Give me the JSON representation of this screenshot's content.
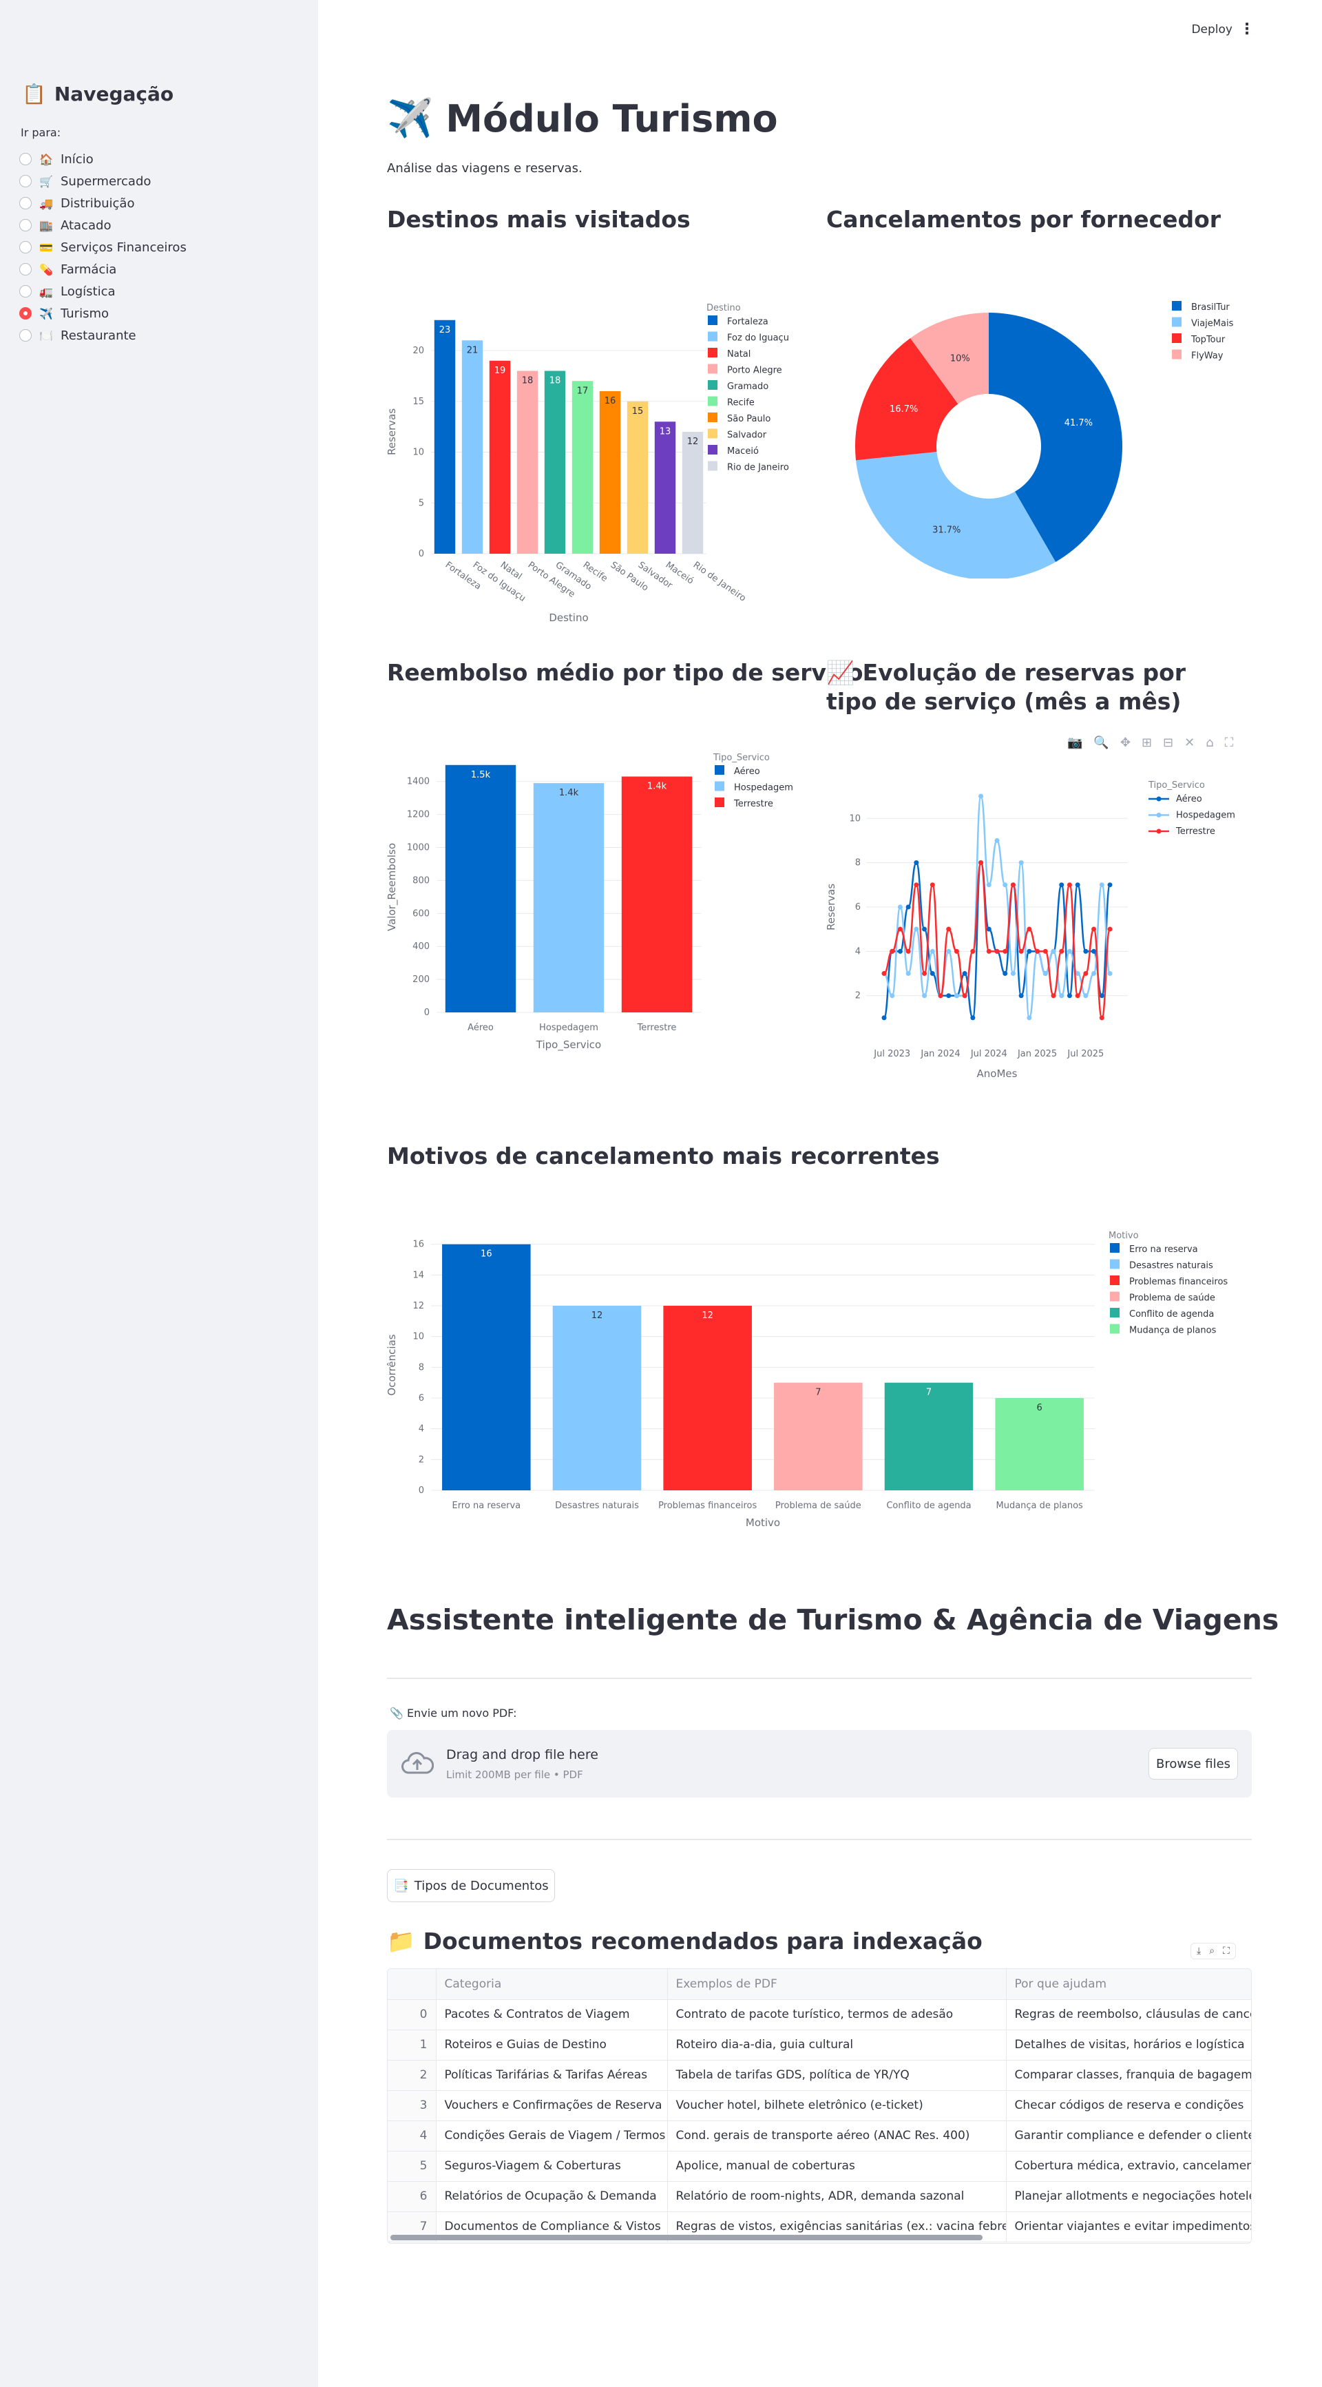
{
  "sidebar": {
    "title": "Navegação",
    "title_icon": "📋",
    "label": "Ir para:",
    "items": [
      {
        "icon": "🏠",
        "label": "Início",
        "selected": false
      },
      {
        "icon": "🛒",
        "label": "Supermercado",
        "selected": false
      },
      {
        "icon": "🚚",
        "label": "Distribuição",
        "selected": false
      },
      {
        "icon": "🏬",
        "label": "Atacado",
        "selected": false
      },
      {
        "icon": "💳",
        "label": "Serviços Financeiros",
        "selected": false
      },
      {
        "icon": "💊",
        "label": "Farmácia",
        "selected": false
      },
      {
        "icon": "🚛",
        "label": "Logística",
        "selected": false
      },
      {
        "icon": "✈️",
        "label": "Turismo",
        "selected": true
      },
      {
        "icon": "🍽️",
        "label": "Restaurante",
        "selected": false
      }
    ]
  },
  "header": {
    "deploy": "Deploy",
    "menu": "⋮"
  },
  "page": {
    "title": "Módulo Turismo",
    "title_icon": "✈️",
    "subtitle": "Análise das viagens e reservas."
  },
  "sections": {
    "destinos": "Destinos mais visitados",
    "cancelamentos": "Cancelamentos por fornecedor",
    "reembolso": "Reembolso médio por tipo de serviço",
    "evolucao_icon": "📈",
    "evolucao": "Evolução de reservas por tipo de serviço (mês a mês)",
    "motivos": "Motivos de cancelamento mais recorrentes",
    "assistente": "Assistente inteligente de Turismo & Agência de Viagens",
    "docs_icon": "📁",
    "docs": "Documentos recomendados para indexação"
  },
  "colors": {
    "palette": [
      "#0068c9",
      "#83c9ff",
      "#ff2b2b",
      "#ffabab",
      "#29b09d",
      "#7defa1",
      "#ff8700",
      "#ffd16a",
      "#6d3fc0",
      "#d5dae5"
    ],
    "accent": "#ff4b4b"
  },
  "chart_data": [
    {
      "type": "bar",
      "title": "",
      "xlabel": "Destino",
      "ylabel": "Reservas",
      "legend_title": "Destino",
      "categories": [
        "Fortaleza",
        "Foz do Iguaçu",
        "Natal",
        "Porto Alegre",
        "Gramado",
        "Recife",
        "São Paulo",
        "Salvador",
        "Maceió",
        "Rio de Janeiro"
      ],
      "values": [
        23,
        21,
        19,
        18,
        18,
        17,
        16,
        15,
        13,
        12
      ],
      "labels": [
        "23",
        "21",
        "19",
        "18",
        "18",
        "17",
        "16",
        "15",
        "13",
        "12"
      ],
      "ylim": [
        0,
        24
      ],
      "yticks": [
        0,
        5,
        10,
        15,
        20
      ],
      "legend": "right",
      "grid": true
    },
    {
      "type": "pie",
      "title": "",
      "hole": true,
      "categories": [
        "BrasilTur",
        "ViajeMais",
        "TopTour",
        "FlyWay"
      ],
      "values": [
        41.7,
        31.7,
        16.7,
        10
      ],
      "labels": [
        "41.7%",
        "31.7%",
        "16.7%",
        "10%"
      ],
      "legend": "right"
    },
    {
      "type": "bar",
      "title": "",
      "xlabel": "Tipo_Servico",
      "ylabel": "Valor_Reembolso",
      "legend_title": "Tipo_Servico",
      "categories": [
        "Aéreo",
        "Hospedagem",
        "Terrestre"
      ],
      "values": [
        1500,
        1390,
        1430
      ],
      "labels": [
        "1.5k",
        "1.4k",
        "1.4k"
      ],
      "ylim": [
        0,
        1520
      ],
      "yticks": [
        0,
        200,
        400,
        600,
        800,
        1000,
        1200,
        1400
      ],
      "legend": "right",
      "grid": true
    },
    {
      "type": "line",
      "title": "",
      "xlabel": "AnoMes",
      "ylabel": "Reservas",
      "legend_title": "Tipo_Servico",
      "x_start": "2023-06",
      "xticks": [
        "Jul 2023",
        "Jan 2024",
        "Jul 2024",
        "Jan 2025",
        "Jul 2025"
      ],
      "ylim": [
        0.5,
        11.5
      ],
      "yticks": [
        2,
        4,
        6,
        8,
        10
      ],
      "legend": "right",
      "grid": true,
      "series": [
        {
          "name": "Aéreo",
          "values": [
            1,
            4,
            4,
            6,
            8,
            5,
            3,
            2,
            2,
            2,
            3,
            1,
            8,
            5,
            4,
            3,
            7,
            2,
            4,
            4,
            3,
            4,
            7,
            2,
            7,
            4,
            4,
            2,
            7
          ]
        },
        {
          "name": "Hospedagem",
          "values": [
            3,
            2,
            6,
            3,
            5,
            2,
            4,
            2,
            4,
            2,
            2,
            4,
            11,
            7,
            9,
            7,
            3,
            8,
            1,
            4,
            3,
            4,
            2,
            4,
            3,
            2,
            3,
            7,
            3
          ]
        },
        {
          "name": "Terrestre",
          "values": [
            3,
            4,
            5,
            4,
            7,
            3,
            7,
            2,
            5,
            4,
            2,
            4,
            8,
            4,
            4,
            4,
            7,
            4,
            5,
            4,
            4,
            2,
            4,
            7,
            2,
            3,
            5,
            1,
            5
          ]
        }
      ]
    },
    {
      "type": "bar",
      "title": "",
      "xlabel": "Motivo",
      "ylabel": "Ocorrências",
      "legend_title": "Motivo",
      "categories": [
        "Erro na reserva",
        "Desastres naturais",
        "Problemas financeiros",
        "Problema de saúde",
        "Conflito de agenda",
        "Mudança de planos"
      ],
      "values": [
        16,
        12,
        12,
        7,
        7,
        6
      ],
      "labels": [
        "16",
        "12",
        "12",
        "7",
        "7",
        "6"
      ],
      "ylim": [
        0,
        16.3
      ],
      "yticks": [
        0,
        2,
        4,
        6,
        8,
        10,
        12,
        14,
        16
      ],
      "legend": "right",
      "grid": true
    }
  ],
  "upload": {
    "icon": "📎",
    "label": "Envie um novo PDF:",
    "drag_text": "Drag and drop file here",
    "limit_text": "Limit 200MB per file • PDF",
    "browse": "Browse files"
  },
  "tipos_button": {
    "icon": "📑",
    "label": "Tipos de Documentos"
  },
  "table": {
    "columns": [
      "",
      "Categoria",
      "Exemplos de PDF",
      "Por que ajudam"
    ],
    "rows": [
      [
        "0",
        "Pacotes & Contratos de Viagem",
        "Contrato de pacote turístico, termos de adesão",
        "Regras de reembolso, cláusulas de cancelamento"
      ],
      [
        "1",
        "Roteiros e Guias de Destino",
        "Roteiro dia-a-dia, guia cultural",
        "Detalhes de visitas, horários e logística"
      ],
      [
        "2",
        "Políticas Tarifárias & Tarifas Aéreas",
        "Tabela de tarifas GDS, política de YR/YQ",
        "Comparar classes, franquia de bagagem, regras t"
      ],
      [
        "3",
        "Vouchers e Confirmações de Reserva",
        "Voucher hotel, bilhete eletrônico (e-ticket)",
        "Checar códigos de reserva e condições"
      ],
      [
        "4",
        "Condições Gerais de Viagem / Termos ANAC",
        "Cond. gerais de transporte aéreo (ANAC Res. 400)",
        "Garantir compliance e defender o cliente"
      ],
      [
        "5",
        "Seguros-Viagem & Coberturas",
        "Apolice, manual de coberturas",
        "Cobertura médica, extravio, cancelamento"
      ],
      [
        "6",
        "Relatórios de Ocupação & Demanda",
        "Relatório de room-nights, ADR, demanda sazonal",
        "Planejar allotments e negociações hoteleiras"
      ],
      [
        "7",
        "Documentos de Compliance & Vistos",
        "Regras de vistos, exigências sanitárias (ex.: vacina febre-amarela)",
        "Orientar viajantes e evitar impedimentos"
      ]
    ]
  }
}
